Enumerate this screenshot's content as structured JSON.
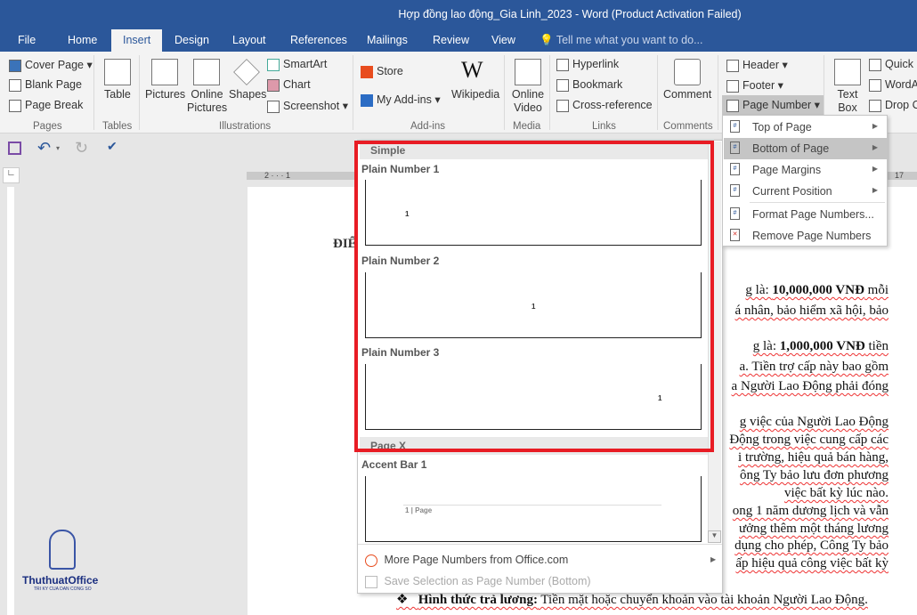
{
  "window": {
    "title": "Hợp đồng lao động_Gia Linh_2023 - Word (Product Activation Failed)"
  },
  "tabs": [
    "File",
    "Home",
    "Insert",
    "Design",
    "Layout",
    "References",
    "Mailings",
    "Review",
    "View"
  ],
  "tell_me": "Tell me what you want to do...",
  "ribbon": {
    "pages": {
      "label": "Pages",
      "items": [
        "Cover Page",
        "Blank Page",
        "Page Break"
      ]
    },
    "tables": {
      "label": "Tables",
      "items": [
        "Table"
      ]
    },
    "illustrations": {
      "label": "Illustrations",
      "items": [
        "Pictures",
        "Online Pictures",
        "Shapes",
        "SmartArt",
        "Chart",
        "Screenshot"
      ]
    },
    "addins": {
      "label": "Add-ins",
      "items": [
        "Store",
        "My Add-ins",
        "Wikipedia"
      ]
    },
    "media": {
      "label": "Media",
      "items": [
        "Online Video"
      ]
    },
    "links": {
      "label": "Links",
      "items": [
        "Hyperlink",
        "Bookmark",
        "Cross-reference"
      ]
    },
    "comments": {
      "label": "Comments",
      "items": [
        "Comment"
      ]
    },
    "header_footer": {
      "items": [
        "Header",
        "Footer",
        "Page Number"
      ]
    },
    "text": {
      "items": [
        "Text Box",
        "Quick Parts",
        "WordArt",
        "Drop Cap"
      ]
    }
  },
  "ruler": {
    "marks": [
      "2",
      "1",
      "17"
    ]
  },
  "page_number_menu": [
    {
      "label": "Top of Page",
      "submenu": true
    },
    {
      "label": "Bottom of Page",
      "submenu": true,
      "highlighted": true
    },
    {
      "label": "Page Margins",
      "submenu": true
    },
    {
      "label": "Current Position",
      "submenu": true
    },
    {
      "label": "Format Page Numbers..."
    },
    {
      "label": "Remove Page Numbers"
    }
  ],
  "gallery": {
    "sections": [
      "Simple",
      "Page X"
    ],
    "items": [
      {
        "label": "Plain Number 1",
        "preview": "1"
      },
      {
        "label": "Plain Number 2",
        "preview": "1"
      },
      {
        "label": "Plain Number 3",
        "preview": "1"
      },
      {
        "label": "Accent Bar 1",
        "preview": "1 | Page"
      }
    ],
    "footer": [
      "More Page Numbers from Office.com",
      "Save Selection as Page Number (Bottom)"
    ]
  },
  "document": {
    "heading_fragment": "ĐIỂ",
    "lines": [
      "g là: 10,000,000 VNĐ mỗi",
      "á nhân, bảo hiểm xã hội, bảo",
      "g là: 1,000,000 VNĐ tiền",
      "a. Tiền trợ cấp này bao gồm",
      "a Người Lao Động phải đóng",
      "g việc của Người Lao Động",
      "Động trong việc cung cấp các",
      "i trường, hiệu quả bán hàng,",
      "ông Ty bảo lưu đơn phương",
      "việc bất kỳ lúc nào.",
      "ong 1 năm dương lịch và vẫn",
      "ưởng thêm một tháng lương",
      "dụng cho phép, Công Ty bảo",
      "ấp hiệu quả công việc bất kỳ"
    ],
    "bullet": {
      "bold": "Hình thức trả lương:",
      "text": " Tiền mặt hoặc chuyển khoản vào tài khoản Người Lao Động."
    }
  },
  "watermark": {
    "brand": "ThuthuatOffice",
    "tagline": "TRI KY CUA DAN CONG SO"
  },
  "colors": {
    "accent": "#2b579a",
    "highlight_box": "#e81c24"
  }
}
